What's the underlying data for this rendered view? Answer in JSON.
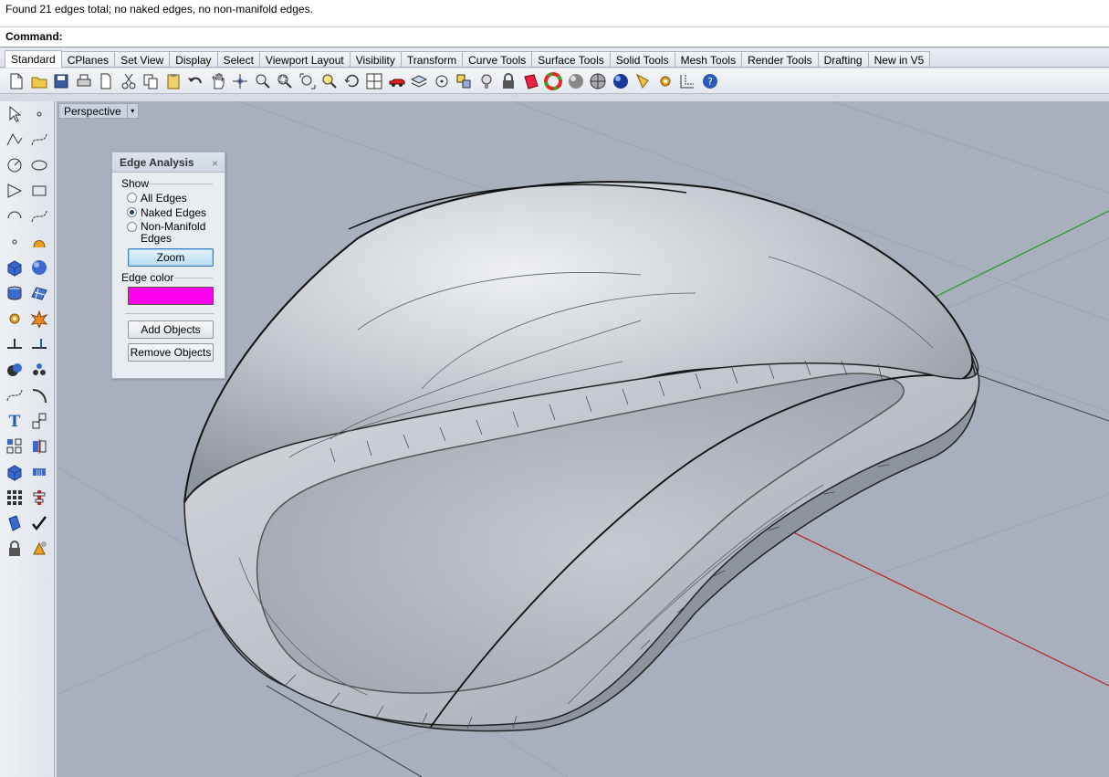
{
  "command_history": "Found 21 edges total; no naked edges, no non-manifold edges.",
  "command_prompt": {
    "label": "Command:",
    "value": ""
  },
  "tabs": [
    {
      "label": "Standard",
      "active": true
    },
    {
      "label": "CPlanes"
    },
    {
      "label": "Set View"
    },
    {
      "label": "Display"
    },
    {
      "label": "Select"
    },
    {
      "label": "Viewport Layout"
    },
    {
      "label": "Visibility"
    },
    {
      "label": "Transform"
    },
    {
      "label": "Curve Tools"
    },
    {
      "label": "Surface Tools"
    },
    {
      "label": "Solid Tools"
    },
    {
      "label": "Mesh Tools"
    },
    {
      "label": "Render Tools"
    },
    {
      "label": "Drafting"
    },
    {
      "label": "New in V5"
    }
  ],
  "toolbar_icons": [
    "new-file-icon",
    "open-folder-icon",
    "save-icon",
    "print-icon",
    "import-icon",
    "cut-icon",
    "copy-icon",
    "paste-icon",
    "undo-icon",
    "pan-hand-icon",
    "rotate-view-icon",
    "zoom-icon",
    "zoom-window-icon",
    "zoom-extents-icon",
    "zoom-selected-icon",
    "undo-view-icon",
    "four-viewports-icon",
    "car-render-icon",
    "layer-icon",
    "object-snap-icon",
    "properties-icon",
    "light-bulb-icon",
    "lock-icon",
    "material-icon",
    "color-wheel-icon",
    "shaded-sphere-icon",
    "ghosted-sphere-icon",
    "rendered-sphere-icon",
    "cone-light-icon",
    "settings-gear-icon",
    "grid-snap-icon",
    "help-icon"
  ],
  "left_tools": [
    [
      "select-arrow-icon",
      "point-icon"
    ],
    [
      "polyline-icon",
      "curve-icon"
    ],
    [
      "circle-icon",
      "ellipse-icon"
    ],
    [
      "polygon-icon",
      "rectangle-icon"
    ],
    [
      "arc-icon",
      "fillet-curve-icon"
    ],
    [
      "surface-from-points-icon",
      "revolve-icon"
    ],
    [
      "box-solid-icon",
      "sphere-solid-icon"
    ],
    [
      "extrude-icon",
      "mesh-plane-icon"
    ],
    [
      "gears-icon",
      "explode-icon"
    ],
    [
      "trim-icon",
      "split-icon"
    ],
    [
      "boolean-union-icon",
      "group-icon"
    ],
    [
      "offset-curve-icon",
      "fillet-edge-icon"
    ],
    [
      "text-icon",
      "scale-icon"
    ],
    [
      "array-icon",
      "mirror-icon"
    ],
    [
      "cube-view-icon",
      "dimension-icon"
    ],
    [
      "grid-array-icon",
      "align-icon"
    ],
    [
      "analyze-icon",
      "check-icon"
    ],
    [
      "block-icon",
      "render-icon"
    ]
  ],
  "viewport": {
    "title": "Perspective",
    "dropdown_glyph": "▾"
  },
  "edge_panel": {
    "title": "Edge Analysis",
    "close_glyph": "×",
    "show_label": "Show",
    "options": [
      {
        "label": "All Edges",
        "checked": false
      },
      {
        "label": "Naked Edges",
        "checked": true
      },
      {
        "label": "Non-Manifold Edges",
        "checked": false
      }
    ],
    "zoom_button": "Zoom",
    "edge_color_label": "Edge color",
    "edge_color": "#ff00ee",
    "add_button": "Add Objects",
    "remove_button": "Remove Objects"
  },
  "colors": {
    "axis_x": "#c02020",
    "axis_y": "#1f9a1f",
    "viewport_bg": "#a7b0bc"
  }
}
